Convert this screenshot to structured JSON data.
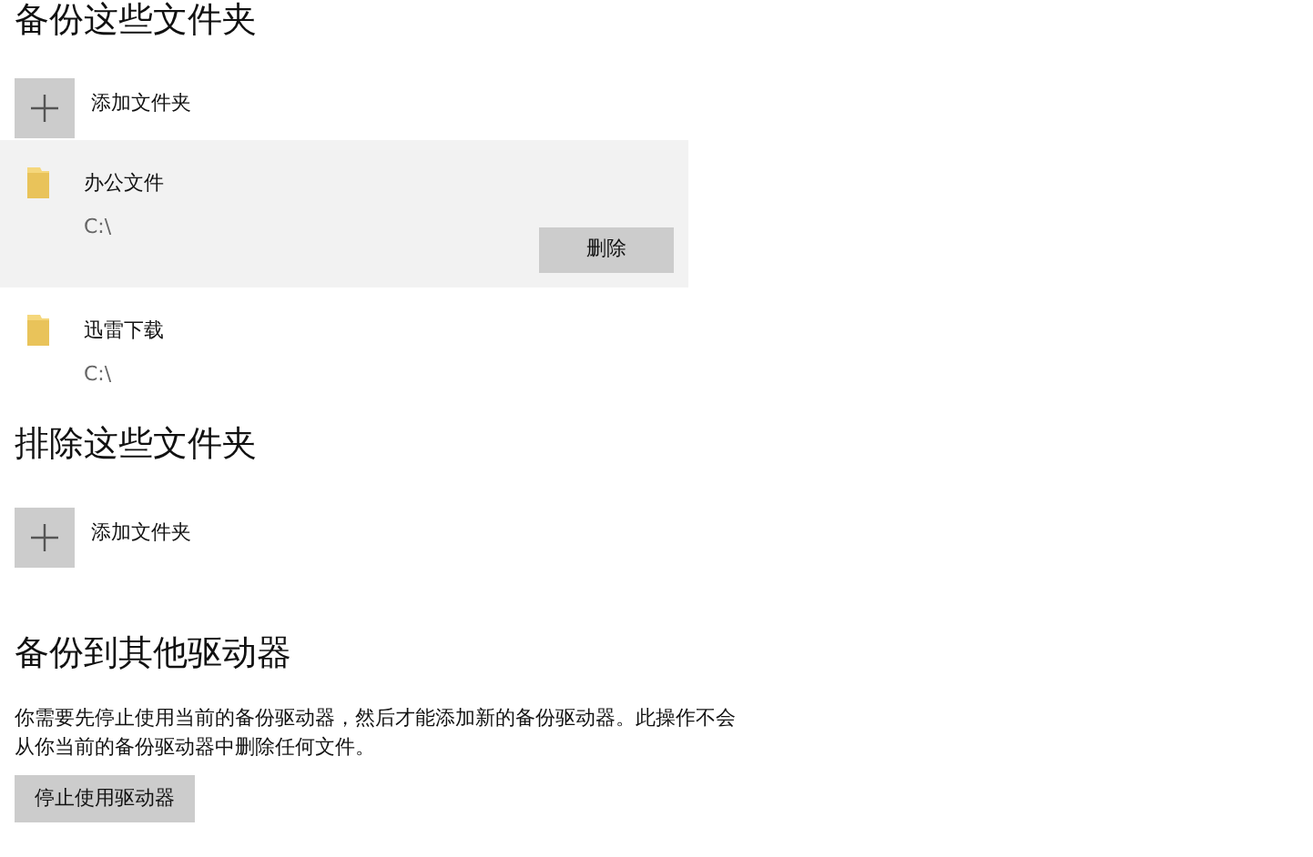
{
  "backup_folders": {
    "title": "备份这些文件夹",
    "add_label": "添加文件夹",
    "folders": [
      {
        "name": "办公文件",
        "path": "C:\\",
        "selected": true,
        "button": "删除"
      },
      {
        "name": "迅雷下载",
        "path": "C:\\",
        "selected": false
      }
    ]
  },
  "exclude_folders": {
    "title": "排除这些文件夹",
    "add_label": "添加文件夹"
  },
  "other_drive": {
    "title": "备份到其他驱动器",
    "text": "你需要先停止使用当前的备份驱动器，然后才能添加新的备份驱动器。此操作不会从你当前的备份驱动器中删除任何文件。",
    "button": "停止使用驱动器"
  }
}
